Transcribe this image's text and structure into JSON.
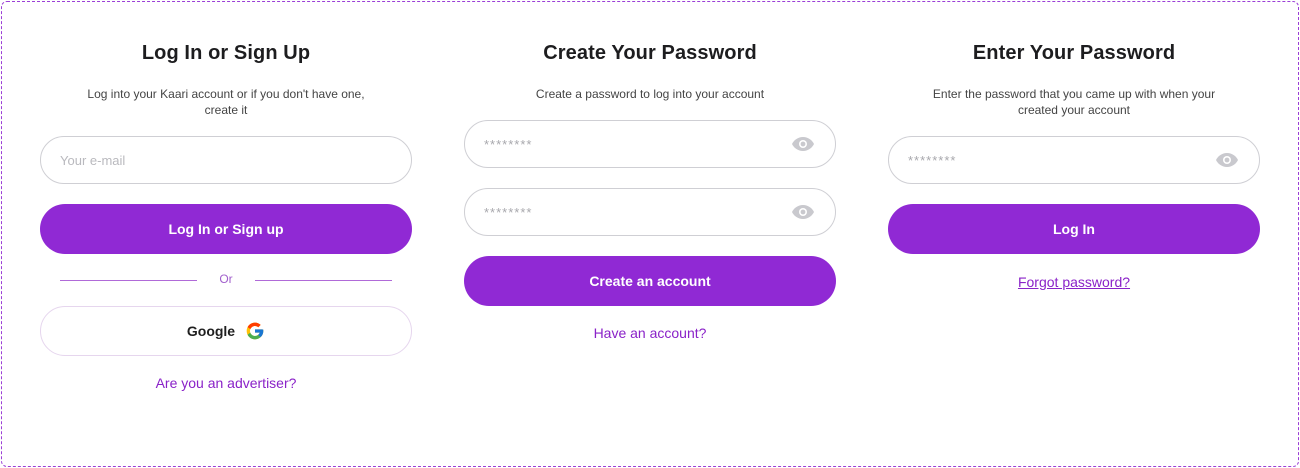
{
  "colors": {
    "accent": "#9029d4",
    "link": "#8a22c8",
    "frame_border": "#9b3fd6",
    "field_border": "#cfcfd4"
  },
  "login_signup": {
    "title": "Log In or Sign Up",
    "subtitle": "Log into your Kaari account or if you don't have one, create it",
    "email_placeholder": "Your e-mail",
    "email_value": "",
    "submit_label": "Log In or Sign up",
    "divider_label": "Or",
    "google_label": "Google",
    "google_icon": "google-logo-icon",
    "advertiser_link": "Are you an advertiser?"
  },
  "create_password": {
    "title": "Create Your Password",
    "subtitle": "Create a password to log into your account",
    "password_placeholder": "********",
    "confirm_placeholder": "********",
    "eye_icon": "eye-icon",
    "submit_label": "Create an account",
    "have_account_link": "Have an account?"
  },
  "enter_password": {
    "title": "Enter Your Password",
    "subtitle": "Enter the password that you came up with when your created your account",
    "password_placeholder": "********",
    "eye_icon": "eye-icon",
    "submit_label": "Log In",
    "forgot_link": "Forgot password?"
  }
}
